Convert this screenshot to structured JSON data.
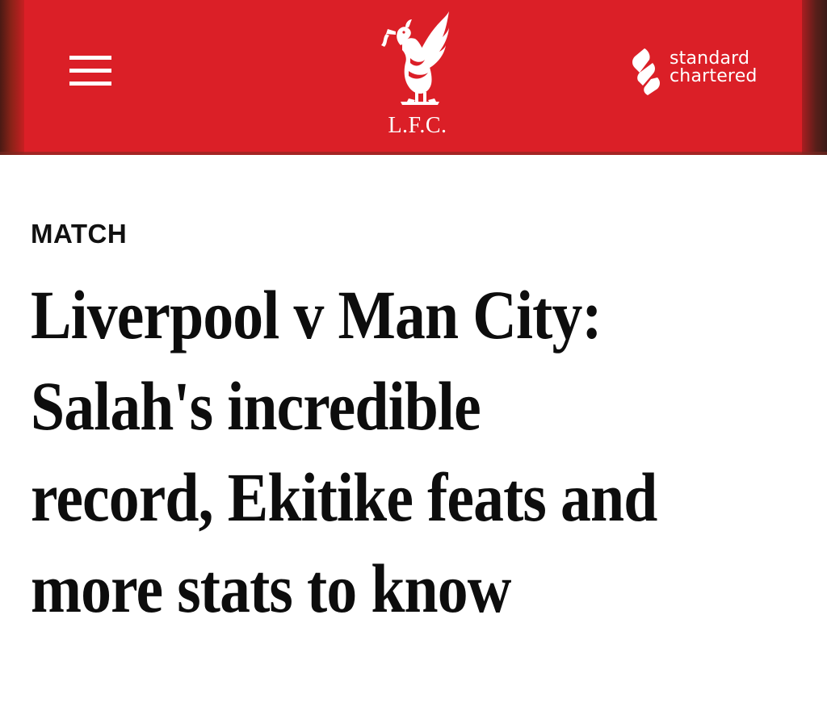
{
  "header": {
    "background_color": "#db1f27",
    "menu_icon": "hamburger-menu-icon",
    "crest": {
      "icon": "liverbird-crest-icon",
      "text": "L.F.C."
    },
    "sponsor": {
      "icon": "standard-chartered-logo-icon",
      "line1": "standard",
      "line2": "chartered"
    }
  },
  "article": {
    "category": "MATCH",
    "headline_lines": [
      "Liverpool v Man City:",
      "Salah's incredible",
      "record, Ekitike feats and",
      "more stats to know"
    ]
  }
}
